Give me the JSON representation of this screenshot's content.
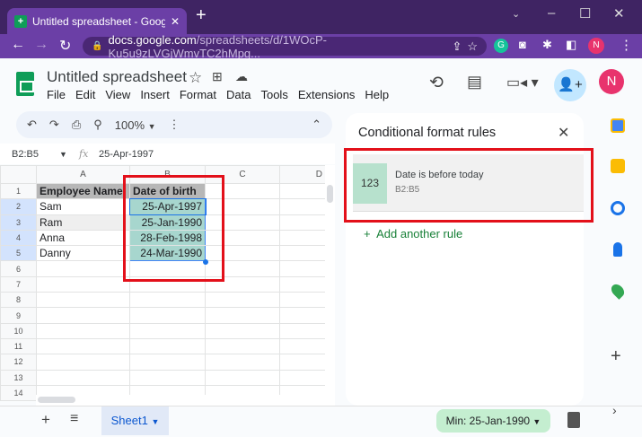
{
  "browser": {
    "tab_title": "Untitled spreadsheet - Google Sh",
    "url_domain": "docs.google.com",
    "url_path": "/spreadsheets/d/1WOcP-Ku5u9zLVGjWmvTC2hMpg...",
    "profile_initial": "N"
  },
  "app": {
    "title": "Untitled spreadsheet",
    "menu": [
      "File",
      "Edit",
      "View",
      "Insert",
      "Format",
      "Data",
      "Tools",
      "Extensions",
      "Help"
    ],
    "avatar_initial": "N"
  },
  "toolbar": {
    "zoom": "100%"
  },
  "formula_bar": {
    "name_box": "B2:B5",
    "fx": "fx",
    "value": "25-Apr-1997"
  },
  "grid": {
    "columns": [
      "A",
      "B",
      "C",
      "D"
    ],
    "rows": [
      [
        "1",
        "Employee Name",
        "Date of birth"
      ],
      [
        "2",
        "Sam",
        "25-Apr-1997"
      ],
      [
        "3",
        "Ram",
        "25-Jan-1990"
      ],
      [
        "4",
        "Anna",
        "28-Feb-1998"
      ],
      [
        "5",
        "Danny",
        "24-Mar-1990"
      ],
      [
        "6",
        "",
        ""
      ],
      [
        "7",
        "",
        ""
      ],
      [
        "8",
        "",
        ""
      ],
      [
        "9",
        "",
        ""
      ],
      [
        "10",
        "",
        ""
      ],
      [
        "11",
        "",
        ""
      ],
      [
        "12",
        "",
        ""
      ],
      [
        "13",
        "",
        ""
      ],
      [
        "14",
        "",
        ""
      ]
    ]
  },
  "bottom": {
    "sheet_tab": "Sheet1",
    "summary": "Min: 25-Jan-1990"
  },
  "panel": {
    "title": "Conditional format rules",
    "rule": {
      "preview": "123",
      "condition": "Date is before today",
      "range": "B2:B5"
    },
    "add_rule": "Add another rule"
  }
}
